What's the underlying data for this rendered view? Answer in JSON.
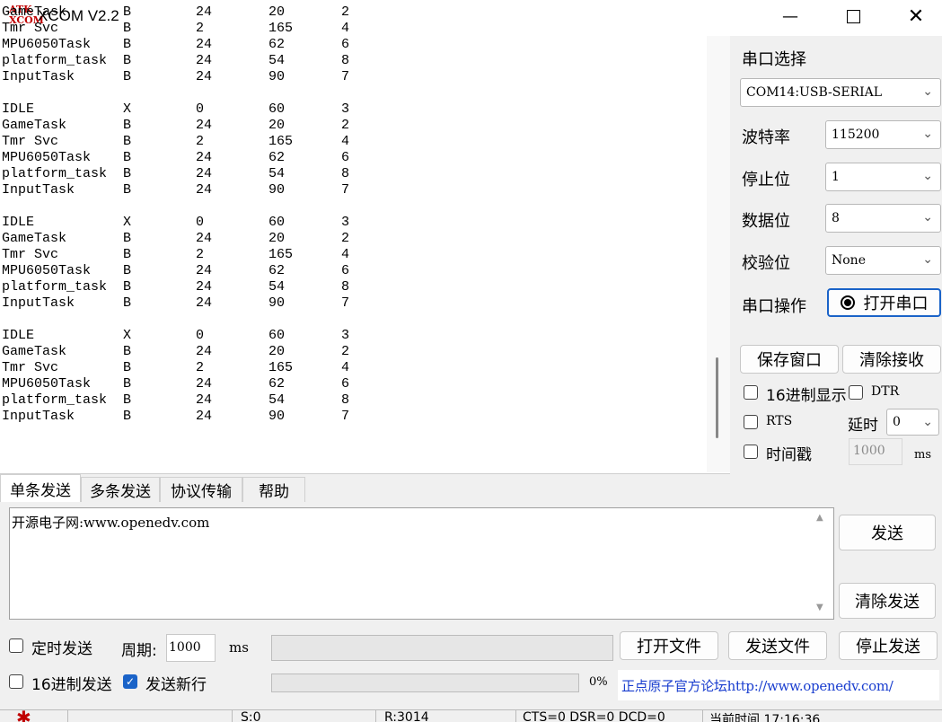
{
  "window": {
    "title": "XCOM V2.2",
    "logo_line1": "ATK",
    "logo_line2": "XCOM"
  },
  "receive": {
    "text": "GameTask       B        24       20       2\nTmr Svc        B        2        165      4\nMPU6050Task    B        24       62       6\nplatform_task  B        24       54       8\nInputTask      B        24       90       7\n\nIDLE           X        0        60       3\nGameTask       B        24       20       2\nTmr Svc        B        2        165      4\nMPU6050Task    B        24       62       6\nplatform_task  B        24       54       8\nInputTask      B        24       90       7\n\nIDLE           X        0        60       3\nGameTask       B        24       20       2\nTmr Svc        B        2        165      4\nMPU6050Task    B        24       62       6\nplatform_task  B        24       54       8\nInputTask      B        24       90       7\n\nIDLE           X        0        60       3\nGameTask       B        24       20       2\nTmr Svc        B        2        165      4\nMPU6050Task    B        24       62       6\nplatform_task  B        24       54       8\nInputTask      B        24       90       7"
  },
  "panel": {
    "port_select_label": "串口选择",
    "port_value": "COM14:USB-SERIAL",
    "baud_label": "波特率",
    "baud_value": "115200",
    "stopbit_label": "停止位",
    "stopbit_value": "1",
    "databit_label": "数据位",
    "databit_value": "8",
    "parity_label": "校验位",
    "parity_value": "None",
    "port_op_label": "串口操作",
    "open_port_button": "打开串口",
    "save_window_button": "保存窗口",
    "clear_receive_button": "清除接收",
    "hex_display_label": "16进制显示",
    "dtr_label": "DTR",
    "rts_label": "RTS",
    "delay_label": "延时",
    "delay_value": "0",
    "timestamp_label": "时间戳",
    "timestamp_value": "1000",
    "timestamp_unit": "ms"
  },
  "tabs": [
    "单条发送",
    "多条发送",
    "协议传输",
    "帮助"
  ],
  "send": {
    "text": "开源电子网:www.openedv.com",
    "send_button": "发送",
    "clear_send_button": "清除发送",
    "timed_send_label": "定时发送",
    "period_label": "周期:",
    "period_value": "1000",
    "period_unit": "ms",
    "open_file_button": "打开文件",
    "send_file_button": "发送文件",
    "stop_send_button": "停止发送",
    "hex_send_label": "16进制发送",
    "newline_label": "发送新行",
    "newline_checked": true,
    "progress_percent": "0%",
    "forum_link": "正点原子官方论坛http://www.openedv.com/"
  },
  "status": {
    "s1": "",
    "s2": "S:0",
    "s3": "R:3014",
    "s4": "CTS=0 DSR=0 DCD=0",
    "s5": "当前时间 17:16:36"
  },
  "colors": {
    "accent": "#1a63c8",
    "link": "#1a3ecf",
    "logo": "#c00000"
  }
}
